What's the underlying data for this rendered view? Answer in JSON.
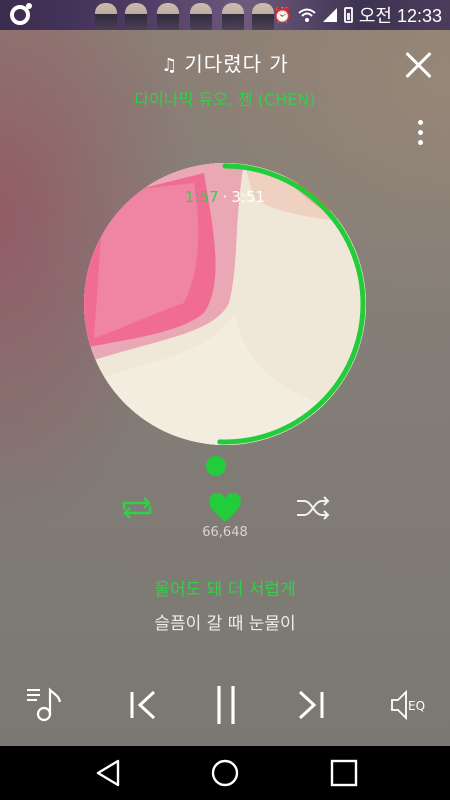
{
  "status_bar": {
    "time": "오전 12:33",
    "icons": [
      "app-logo-icon",
      "alarm-icon",
      "wifi-icon",
      "signal-icon",
      "battery-icon"
    ]
  },
  "player": {
    "title": "기다렸다 가",
    "title_icon": "headphone-note-icon",
    "artist": "다이나믹 듀오, 첸 (CHEN)",
    "elapsed": "1:57",
    "separator": "·",
    "duration": "3:51",
    "progress": 0.506,
    "like_count": "66,648"
  },
  "lyrics": {
    "current": "울어도 돼 더 서럽게",
    "next": "슬픔이 갈 때 눈물이"
  },
  "colors": {
    "accent": "#22cc3a",
    "accent_text": "#32d048",
    "background": "#7d7973",
    "nav_bar": "#000000"
  },
  "controls": {
    "eq_label": "EQ"
  }
}
